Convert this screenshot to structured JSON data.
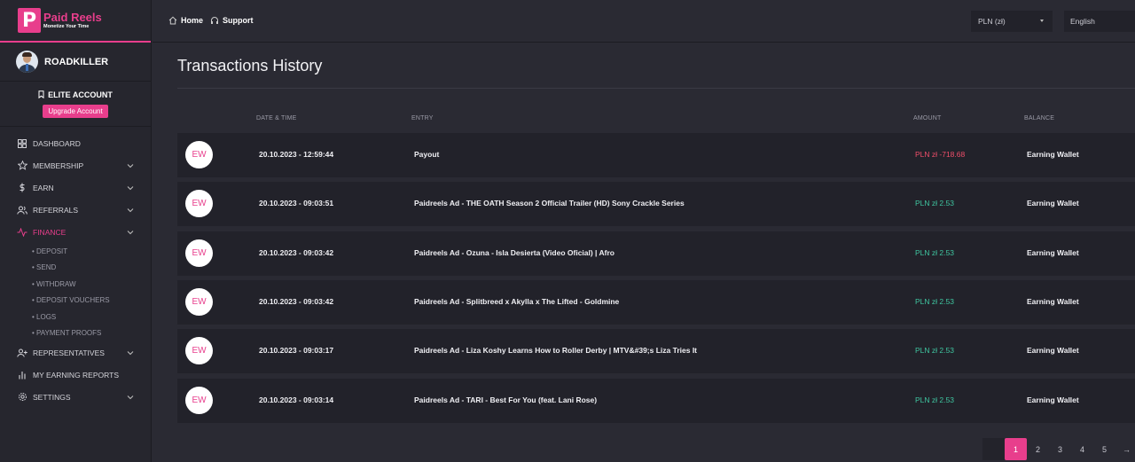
{
  "brand": {
    "name": "Paid Reels",
    "tagline": "Monetize Your Time",
    "logo_letter": "P",
    "accent": "#e83e8c"
  },
  "user": {
    "name": "ROADKILLER",
    "account_type": "ELITE ACCOUNT",
    "upgrade_label": "Upgrade Account"
  },
  "nav": [
    {
      "label": "DASHBOARD",
      "icon": "dashboard-icon",
      "expandable": false
    },
    {
      "label": "MEMBERSHIP",
      "icon": "star-icon",
      "expandable": true
    },
    {
      "label": "EARN",
      "icon": "dollar-icon",
      "expandable": true
    },
    {
      "label": "REFERRALS",
      "icon": "users-icon",
      "expandable": true
    },
    {
      "label": "FINANCE",
      "icon": "activity-icon",
      "expandable": true,
      "active": true
    },
    {
      "label": "REPRESENTATIVES",
      "icon": "user-plus-icon",
      "expandable": true
    },
    {
      "label": "MY EARNING REPORTS",
      "icon": "bar-chart-icon",
      "expandable": false
    },
    {
      "label": "SETTINGS",
      "icon": "gear-icon",
      "expandable": true
    }
  ],
  "finance_sub": [
    "• DEPOSIT",
    "• SEND",
    "• WITHDRAW",
    "• DEPOSIT VOUCHERS",
    "• LOGS",
    "• PAYMENT PROOFS"
  ],
  "topbar": {
    "home": "Home",
    "support": "Support",
    "currency": "PLN (zł)",
    "language": "English"
  },
  "page": {
    "title": "Transactions History"
  },
  "table": {
    "columns": {
      "date": "DATE & TIME",
      "entry": "ENTRY",
      "amount": "AMOUNT",
      "balance": "BALANCE"
    },
    "rows": [
      {
        "badge": "EW",
        "date": "20.10.2023 - 12:59:44",
        "entry": "Payout",
        "amount": "PLN zł -718.68",
        "amount_type": "negative",
        "balance": "Earning Wallet"
      },
      {
        "badge": "EW",
        "date": "20.10.2023 - 09:03:51",
        "entry": "Paidreels Ad - THE OATH Season 2 Official Trailer (HD) Sony Crackle Series",
        "amount": "PLN zł 2.53",
        "amount_type": "positive",
        "balance": "Earning Wallet"
      },
      {
        "badge": "EW",
        "date": "20.10.2023 - 09:03:42",
        "entry": "Paidreels Ad - Ozuna - Isla Desierta (Video Oficial) | Afro",
        "amount": "PLN zł 2.53",
        "amount_type": "positive",
        "balance": "Earning Wallet"
      },
      {
        "badge": "EW",
        "date": "20.10.2023 - 09:03:42",
        "entry": "Paidreels Ad - Splitbreed x Akylla x The Lifted - Goldmine",
        "amount": "PLN zł 2.53",
        "amount_type": "positive",
        "balance": "Earning Wallet"
      },
      {
        "badge": "EW",
        "date": "20.10.2023 - 09:03:17",
        "entry": "Paidreels Ad - Liza Koshy Learns How to Roller Derby | MTV&#39;s Liza Tries It",
        "amount": "PLN zł 2.53",
        "amount_type": "positive",
        "balance": "Earning Wallet"
      },
      {
        "badge": "EW",
        "date": "20.10.2023 - 09:03:14",
        "entry": "Paidreels Ad - TARI - Best For You (feat. Lani Rose)",
        "amount": "PLN zł 2.53",
        "amount_type": "positive",
        "balance": "Earning Wallet"
      }
    ]
  },
  "pagination": {
    "pages": [
      "1",
      "2",
      "3",
      "4",
      "5"
    ],
    "current": "1",
    "next": "→"
  },
  "colors": {
    "negative": "#f04e6a",
    "positive": "#3fc6a0",
    "background": "#2a2a33",
    "row": "#22222a"
  }
}
